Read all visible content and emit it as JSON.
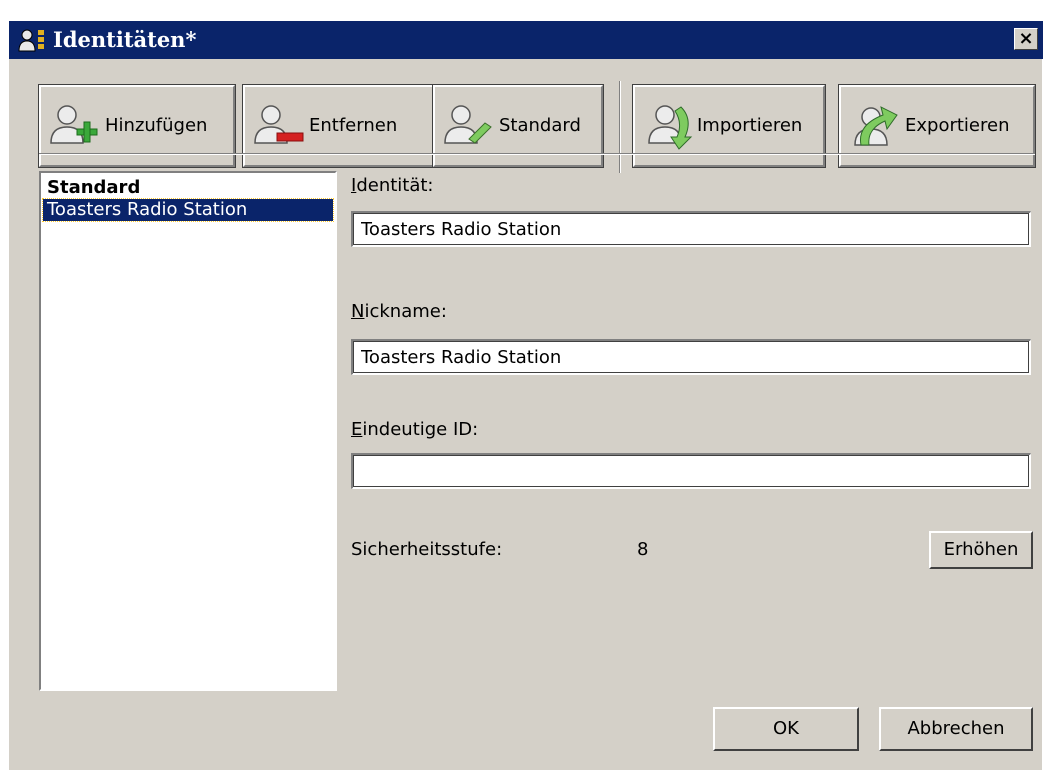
{
  "window": {
    "title": "Identitäten*",
    "close_label": "×"
  },
  "toolbar": {
    "add_label": "Hinzufügen",
    "remove_label": "Entfernen",
    "default_label": "Standard",
    "import_label": "Importieren",
    "export_label": "Exportieren"
  },
  "identity_list": {
    "items": [
      {
        "label": "Standard",
        "bold": true,
        "selected": false
      },
      {
        "label": "Toasters Radio Station",
        "bold": false,
        "selected": true
      }
    ]
  },
  "form": {
    "identity_label_accel": "I",
    "identity_label_rest": "dentität:",
    "identity_value": "Toasters Radio Station",
    "nickname_label_accel": "N",
    "nickname_label_rest": "ickname:",
    "nickname_value": "Toasters Radio Station",
    "uid_label_accel": "E",
    "uid_label_rest": "indeutige ID:",
    "uid_value": "",
    "security_label": "Sicherheitsstufe:",
    "security_value": "8",
    "raise_label": "Erhöhen"
  },
  "footer": {
    "ok_label": "OK",
    "cancel_label": "Abbrechen"
  },
  "colors": {
    "face": "#d4d0c8",
    "title_bar": "#0a246a",
    "selection": "#0a246a",
    "plus": "#3aa83a",
    "minus": "#d42020"
  },
  "icons": [
    "user-add-icon",
    "user-remove-icon",
    "user-default-icon",
    "import-icon",
    "export-icon",
    "identities-icon"
  ]
}
